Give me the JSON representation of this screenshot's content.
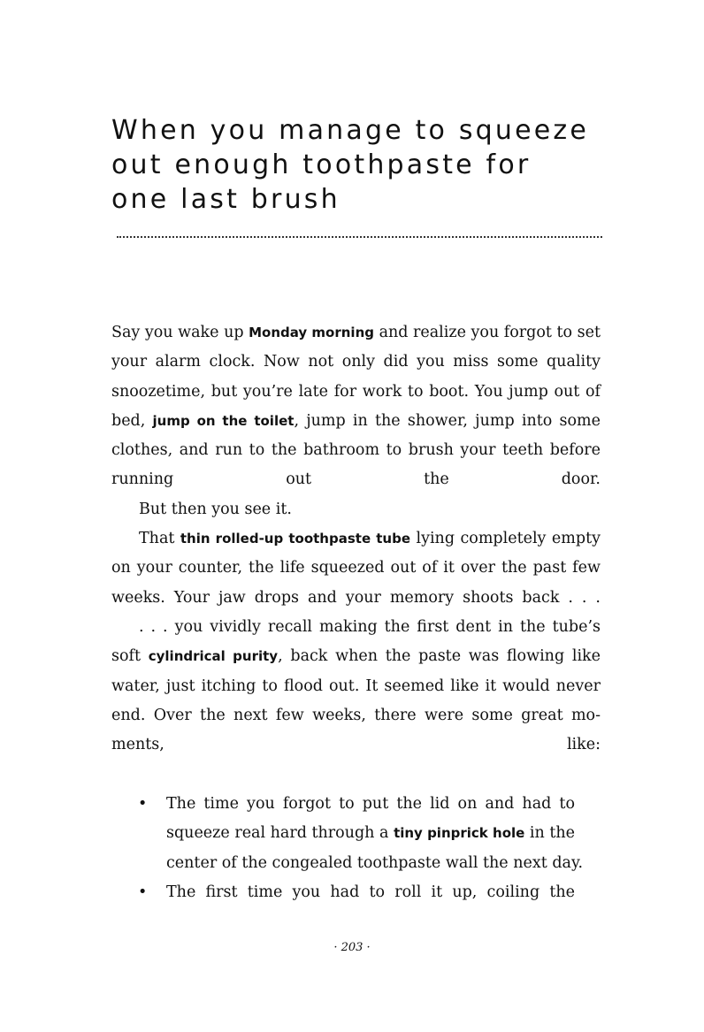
{
  "title_lines": [
    "When you manage to squeeze",
    "out enough toothpaste for",
    "one last brush"
  ],
  "p1": {
    "l1a": "Say you wake up ",
    "l1b": "Monday morning",
    "l1c": " and realize you forgot to set",
    "l2": "your alarm clock. Now not only did you miss some quality",
    "l3": "snoozetime, but you’re late for work to boot. You jump out of",
    "l4a": "bed, ",
    "l4b": "jump on the toilet",
    "l4c": ", jump in the shower, jump into some",
    "l5": "clothes, and run to the bathroom to brush your teeth before",
    "l6": "running out the door."
  },
  "p2": "But then you see it.",
  "p3": {
    "l1a": "That ",
    "l1b": "thin rolled-up toothpaste tube",
    "l1c": " lying completely empty",
    "l2": "on your counter, the life squeezed out of it over the past few",
    "l3": "weeks. Your jaw drops and your memory shoots back . . ."
  },
  "p4": {
    "l1": ". . . you vividly recall making the first dent in the tube’s",
    "l2a": "soft ",
    "l2b": "cylindrical purity",
    "l2c": ", back when the paste was flowing like",
    "l3": "water, just itching to flood out. It seemed like it would never",
    "l4": "end. Over the next few weeks, there were some great mo-",
    "l5": "ments, like:"
  },
  "bullets": {
    "symbol": "•",
    "item1": {
      "l1": "The time you forgot to put the lid on and had to",
      "l2a": "squeeze real hard through a ",
      "l2b": "tiny pinprick hole",
      "l2c": " in the",
      "l3": "center of the congealed toothpaste wall the next day."
    },
    "item2": {
      "l1": "The first time you had to roll it up, coiling the"
    }
  },
  "page_number": "· 203 ·"
}
